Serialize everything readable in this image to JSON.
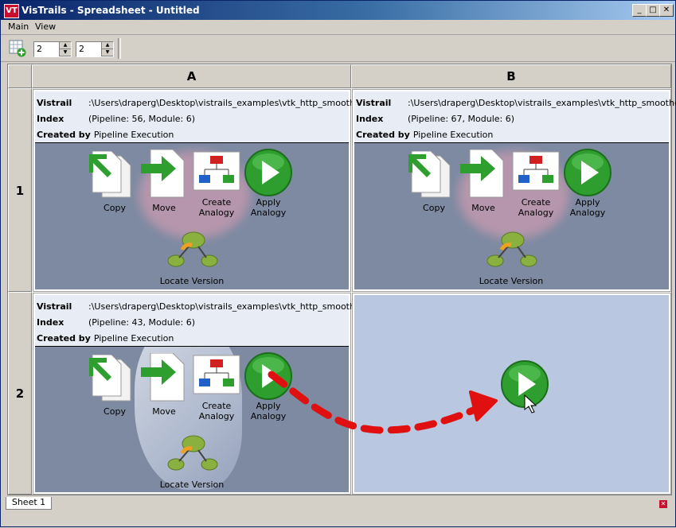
{
  "window": {
    "title": "VisTrails - Spreadsheet - Untitled",
    "app_icon": "VT",
    "minimize": "_",
    "maximize": "□",
    "close": "✕"
  },
  "menu": {
    "items": [
      "Main",
      "View"
    ]
  },
  "toolbar": {
    "rows_value": "2",
    "cols_value": "2"
  },
  "columns": [
    "A",
    "B"
  ],
  "rows": [
    "1",
    "2"
  ],
  "labels": {
    "vistrail": "Vistrail",
    "index": "Index",
    "created_by": "Created by"
  },
  "icons": {
    "copy": "Copy",
    "move": "Move",
    "create_analogy": "Create\nAnalogy",
    "apply_analogy": "Apply\nAnalogy",
    "locate_version": "Locate Version"
  },
  "cells": {
    "a1": {
      "vistrail": ":\\Users\\draperg\\Desktop\\vistrails_examples\\vtk_http_smoothed.vt",
      "index": "(Pipeline: 56, Module: 6)",
      "created_by": "Pipeline Execution"
    },
    "b1": {
      "vistrail": ":\\Users\\draperg\\Desktop\\vistrails_examples\\vtk_http_smoothed.vt",
      "index": "(Pipeline: 67, Module: 6)",
      "created_by": "Pipeline Execution"
    },
    "a2": {
      "vistrail": ":\\Users\\draperg\\Desktop\\vistrails_examples\\vtk_http_smoothed.vt",
      "index": "(Pipeline: 43, Module: 6)",
      "created_by": "Pipeline Execution"
    }
  },
  "tabs": [
    "Sheet 1"
  ],
  "colors": {
    "title_start": "#0a246a",
    "render_bg": "#7d8aa2",
    "empty_bg": "#b9c8e0",
    "arrow": "#e01010",
    "play_green": "#2e9e2e"
  }
}
